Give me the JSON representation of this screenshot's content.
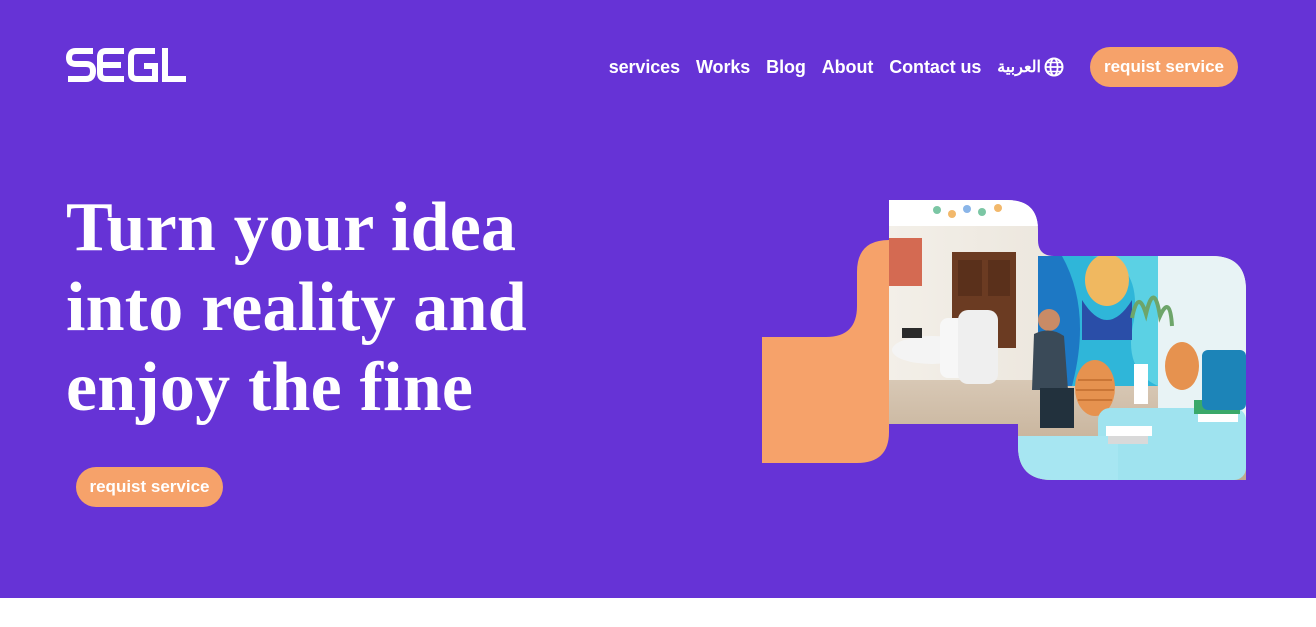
{
  "brand": {
    "logo_text": "SEGL"
  },
  "nav": {
    "links": [
      "services",
      "Works",
      "Blog",
      "About",
      "Contact us"
    ],
    "language_label": "العربية",
    "language_icon": "globe-icon",
    "cta_label": "requist service"
  },
  "hero": {
    "headline_lines": [
      "Turn your idea",
      "into reality and",
      "enjoy the fine"
    ],
    "cta_label": "requist service",
    "image_description_icon": "interior-photo"
  },
  "colors": {
    "background": "#6633d6",
    "accent": "#f6a26a",
    "text": "#ffffff",
    "footer_strip": "#ffffff"
  }
}
